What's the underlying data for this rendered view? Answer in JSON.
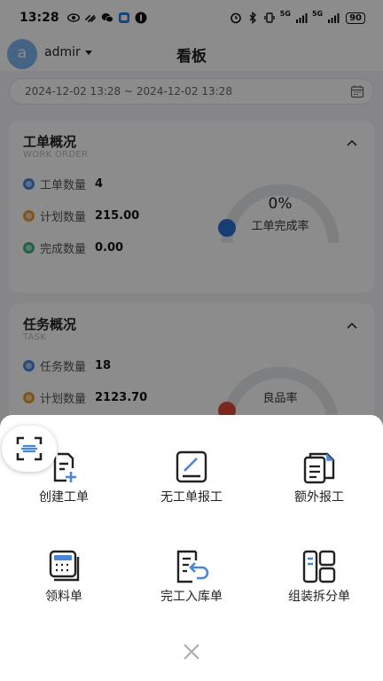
{
  "status_bar": {
    "time": "13:28",
    "net_left": "5G",
    "net_right": "5G",
    "battery": "90"
  },
  "header": {
    "avatar_letter": "a",
    "user_name": "admir",
    "title": "看板"
  },
  "filter": {
    "date_range": "2024-12-02 13:28 ~ 2024-12-02 13:28"
  },
  "work_order_card": {
    "title": "工单概况",
    "subtitle": "WORK ORDER",
    "stats": [
      {
        "label": "工单数量",
        "value": "4",
        "color": "#4a86d8"
      },
      {
        "label": "计划数量",
        "value": "215.00",
        "color": "#e59a3c"
      },
      {
        "label": "完成数量",
        "value": "0.00",
        "color": "#3fb27f"
      }
    ],
    "gauge_percent": "0%",
    "gauge_label": "工单完成率",
    "gauge_value": 0,
    "gauge_color": "#2f6fd6"
  },
  "task_card": {
    "title": "任务概况",
    "subtitle": "TASK",
    "stats": [
      {
        "label": "任务数量",
        "value": "18",
        "color": "#4a86d8"
      },
      {
        "label": "计划数量",
        "value": "2123.70",
        "color": "#e59a3c"
      }
    ],
    "gauge_label": "良品率",
    "gauge_color": "#e04a3a"
  },
  "actions": [
    {
      "label": "创建工单",
      "icon": "create-order-icon"
    },
    {
      "label": "无工单报工",
      "icon": "report-without-order-icon"
    },
    {
      "label": "额外报工",
      "icon": "extra-report-icon"
    },
    {
      "label": "领料单",
      "icon": "material-requisition-icon"
    },
    {
      "label": "完工入库单",
      "icon": "completion-warehouse-icon"
    },
    {
      "label": "组装拆分单",
      "icon": "assembly-split-icon"
    }
  ],
  "colors": {
    "accent": "#4a86d8",
    "avatar": "#7fb6ee",
    "overlay": "rgba(0,0,0,0.45)"
  }
}
